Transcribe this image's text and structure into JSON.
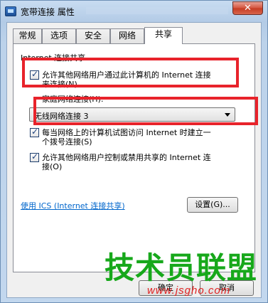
{
  "window": {
    "title": "宽带连接 属性",
    "close_label": "✕"
  },
  "tabs": [
    {
      "label": "常规"
    },
    {
      "label": "选项"
    },
    {
      "label": "安全"
    },
    {
      "label": "网络"
    },
    {
      "label": "共享",
      "active": true
    }
  ],
  "sharing": {
    "section_title": "Internet 连接共享",
    "allow_share": {
      "checked": true,
      "label_line1": "允许其他网络用户通过此计算机的 Internet 连接",
      "label_line2": "来连接(N)"
    },
    "home_network_label": "家庭网络连接(H):",
    "home_network_value": "无线网络连接 3",
    "dial_on_demand": {
      "checked": true,
      "label_line1": "每当网络上的计算机试图访问 Internet 时建立一",
      "label_line2": "个拨号连接(S)"
    },
    "allow_control": {
      "checked": true,
      "label_line1": "允许其他网络用户控制或禁用共享的 Internet 连",
      "label_line2": "接(O)"
    },
    "ics_link": "使用 ICS (Internet 连接共享)",
    "settings_button": "设置(G)..."
  },
  "footer": {
    "ok_button": "确定",
    "cancel_button": "取消"
  },
  "overlay": {
    "watermark_text": "技术员联盟",
    "watermark_url": "www.jsgho.com",
    "highlight_color": "#e8232b",
    "watermark_color": "#17a81b"
  }
}
